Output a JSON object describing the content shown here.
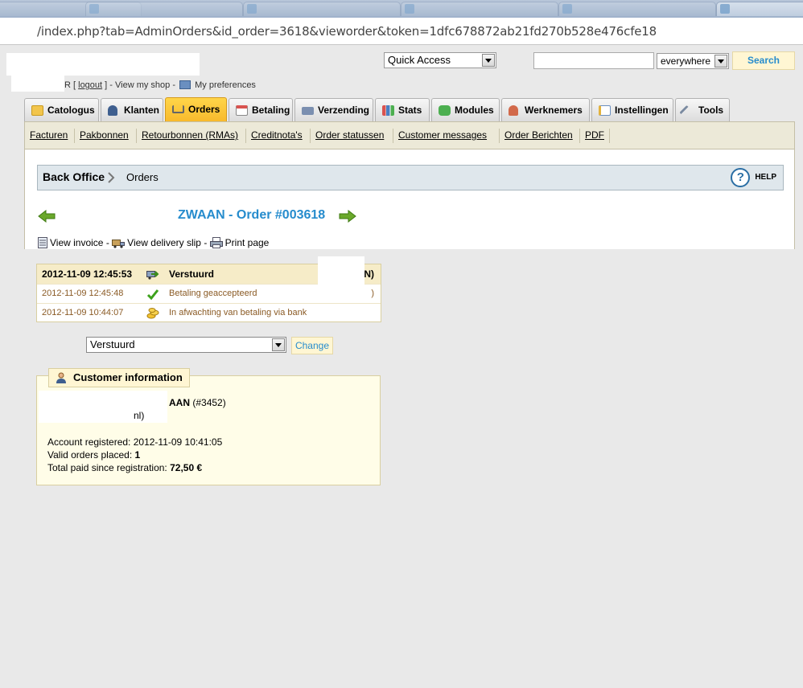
{
  "browser": {
    "address": "/index.php?tab=AdminOrders&id_order=3618&vieworder&token=1dfc678872ab21fd270b528e476cfe18"
  },
  "header": {
    "user_initial_tail": "R",
    "logout_label": "logout",
    "view_shop_label": "View my shop",
    "preferences_label": "My preferences",
    "quick_access_label": "Quick Access",
    "search_placeholder": "",
    "search_scope": "everywhere",
    "search_button": "Search"
  },
  "main_tabs": [
    {
      "label": "Catologus",
      "icon": "folder-icon",
      "color": "#f0c24a"
    },
    {
      "label": "Klanten",
      "icon": "customer-icon",
      "color": "#5a7db4"
    },
    {
      "label": "Orders",
      "icon": "cart-icon",
      "color": "#8c8c8c"
    },
    {
      "label": "Betaling",
      "icon": "payment-icon",
      "color": "#d9534f"
    },
    {
      "label": "Verzending",
      "icon": "truck-icon",
      "color": "#6b7fa1"
    },
    {
      "label": "Stats",
      "icon": "chart-icon",
      "color": "#4a7fc1"
    },
    {
      "label": "Modules",
      "icon": "puzzle-icon",
      "color": "#4caf50"
    },
    {
      "label": "Werknemers",
      "icon": "employee-icon",
      "color": "#d2694a"
    },
    {
      "label": "Instellingen",
      "icon": "settings-icon",
      "color": "#4a90c2"
    },
    {
      "label": "Tools",
      "icon": "wrench-icon",
      "color": "#7a8aa0"
    }
  ],
  "sub_tabs": [
    "Facturen",
    "Pakbonnen",
    "Retourbonnen (RMAs)",
    "Creditnota's",
    "Order statussen",
    "Customer messages",
    "Order Berichten",
    "PDF"
  ],
  "breadcrumb": {
    "root": "Back Office",
    "current": "Orders"
  },
  "help_label": "HELP",
  "order": {
    "title": "ZWAAN - Order #003618",
    "view_invoice": "View invoice",
    "view_delivery_slip": "View delivery slip",
    "print_page": "Print page"
  },
  "history": [
    {
      "date": "2012-11-09 12:45:53",
      "state": "Verstuurd",
      "employee": "N)",
      "icon": "truck-icon"
    },
    {
      "date": "2012-11-09 12:45:48",
      "state": "Betaling geaccepteerd",
      "employee": ")",
      "icon": "check-icon"
    },
    {
      "date": "2012-11-09 10:44:07",
      "state": "In afwachting van betaling via bank",
      "employee": "",
      "icon": "coins-icon"
    }
  ],
  "status_select": {
    "value": "Verstuurd",
    "change_button": "Change"
  },
  "customer": {
    "legend": "Customer information",
    "name_tail": "AAN",
    "customer_id": "(#3452)",
    "email_tail": "nl)",
    "account_registered_label": "Account registered:",
    "account_registered": "2012-11-09 10:41:05",
    "valid_orders_label": "Valid orders placed:",
    "valid_orders": "1",
    "total_paid_label": "Total paid since registration:",
    "total_paid": "72,50 €"
  }
}
